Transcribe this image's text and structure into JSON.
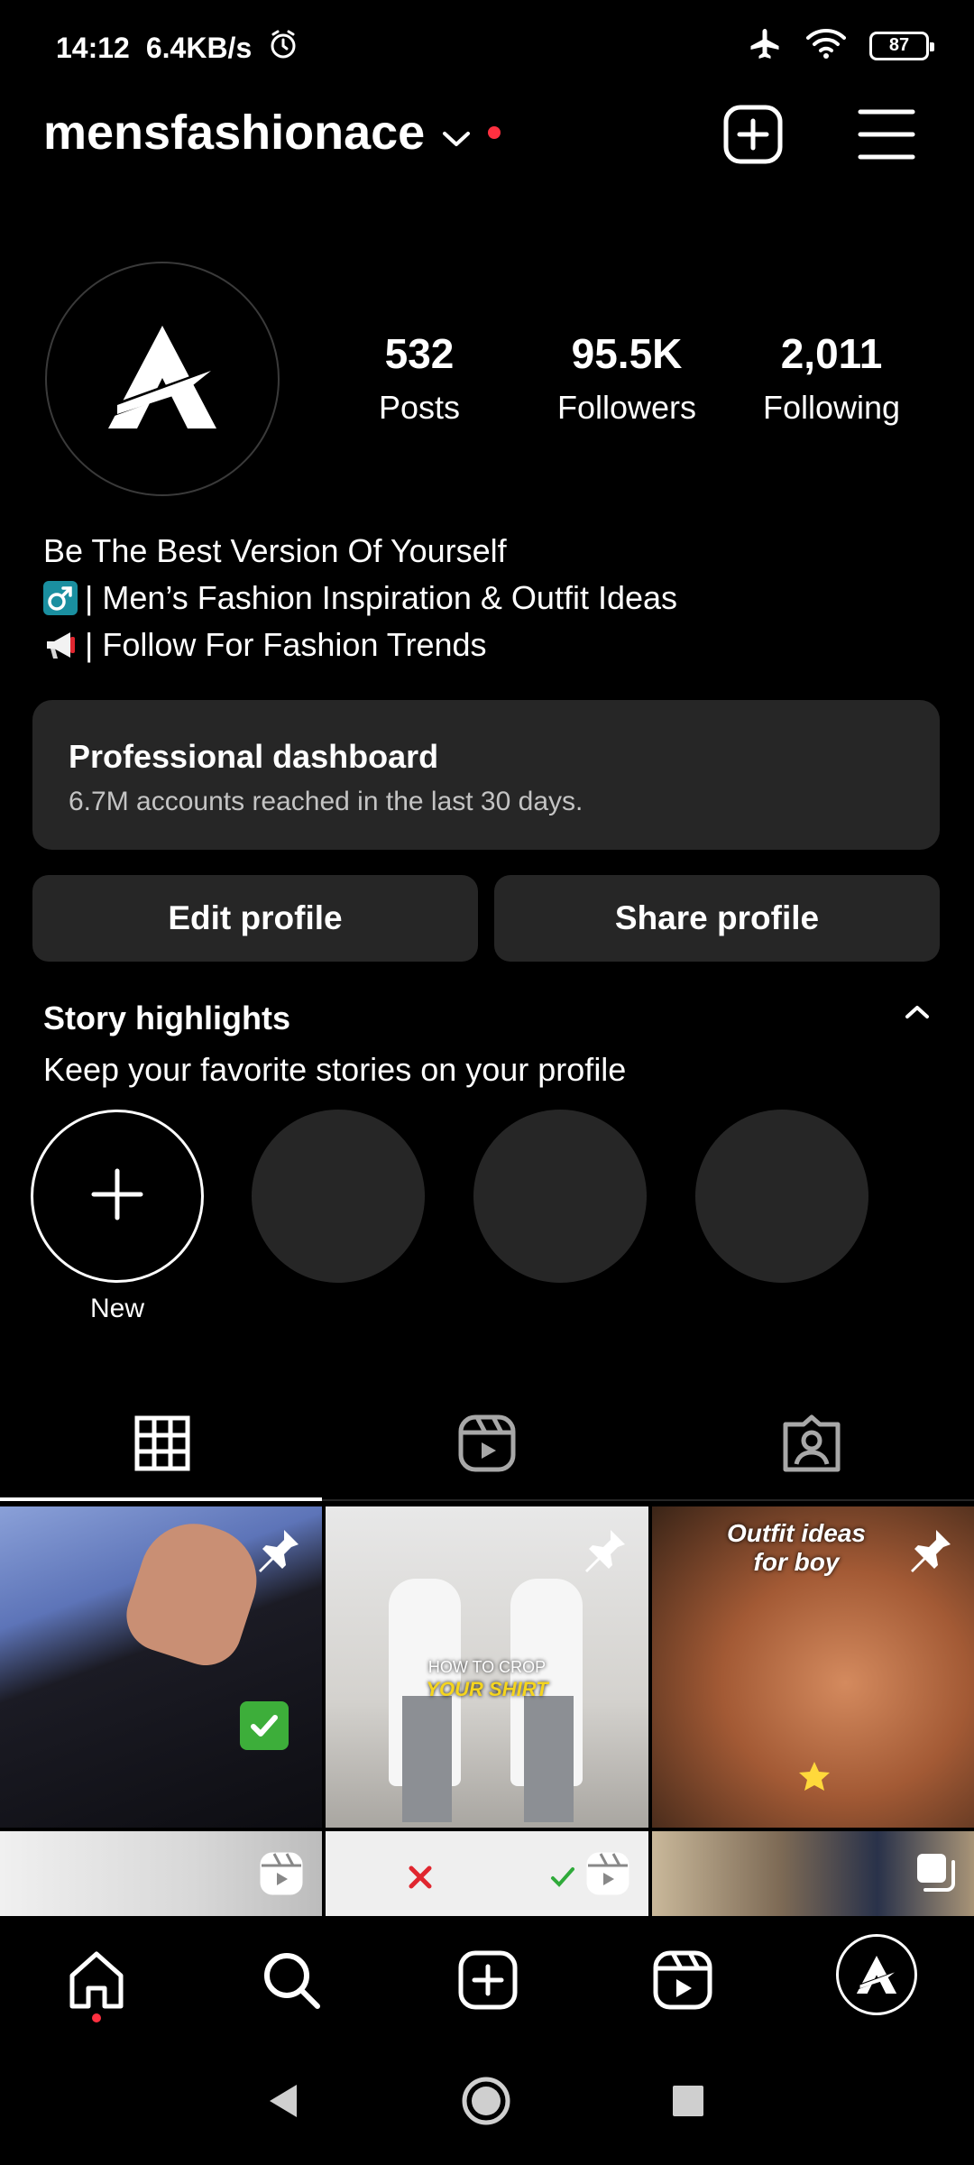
{
  "status_bar": {
    "time": "14:12",
    "net_speed": "6.4KB/s",
    "battery": "87",
    "icons": [
      "alarm-icon",
      "airplane-icon",
      "wifi-icon",
      "battery-icon"
    ]
  },
  "header": {
    "username": "mensfashionace",
    "icons": [
      "chevron-down-icon",
      "notification-dot",
      "create-post-icon",
      "menu-icon"
    ]
  },
  "profile": {
    "stats": [
      {
        "value": "532",
        "label": "Posts"
      },
      {
        "value": "95.5K",
        "label": "Followers"
      },
      {
        "value": "2,011",
        "label": "Following"
      }
    ],
    "bio": [
      "Be The Best Version Of Yourself",
      "| Men’s Fashion Inspiration & Outfit Ideas",
      "| Follow For Fashion Trends"
    ],
    "bio_emojis": [
      "male-sign-emoji",
      "megaphone-emoji"
    ]
  },
  "dashboard": {
    "title": "Professional dashboard",
    "subtitle": "6.7M accounts reached in the last 30 days."
  },
  "actions": {
    "edit": "Edit profile",
    "share": "Share profile"
  },
  "highlights": {
    "title": "Story highlights",
    "subtitle": "Keep your favorite stories on your profile",
    "new_label": "New"
  },
  "tabs": [
    "grid-icon",
    "reels-icon",
    "tagged-icon"
  ],
  "grid": {
    "posts": [
      {
        "type": "pinned",
        "caption_lines": []
      },
      {
        "type": "pinned",
        "caption_lines": [
          "HOW TO CROP",
          "YOUR SHIRT"
        ]
      },
      {
        "type": "pinned",
        "caption_lines": [
          "Outfit ideas",
          "for boy"
        ]
      },
      {
        "type": "reel",
        "caption_lines": []
      },
      {
        "type": "reel",
        "caption_lines": []
      },
      {
        "type": "carousel",
        "caption_lines": []
      }
    ]
  },
  "bottom_nav": [
    "home-icon",
    "search-icon",
    "create-icon",
    "reels-icon",
    "profile-avatar"
  ],
  "colors": {
    "background": "#000000",
    "surface": "#262626",
    "accent_red": "#ff3040",
    "text": "#ffffff",
    "muted": "#c4c4c4"
  }
}
